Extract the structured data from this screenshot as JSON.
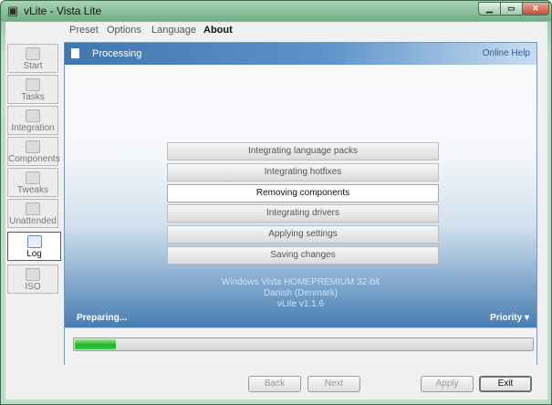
{
  "window": {
    "title": "vLite - Vista Lite",
    "app_icon": "vlite-app-icon",
    "controls": {
      "minimize": "▁",
      "maximize": "▭",
      "close": "✕"
    }
  },
  "menu": [
    "Preset",
    "Options",
    "Language",
    "About"
  ],
  "sidebar": {
    "items": [
      {
        "label": "Start",
        "icon": "start-icon",
        "active": false
      },
      {
        "label": "Tasks",
        "icon": "tasks-icon",
        "active": false
      },
      {
        "label": "Integration",
        "icon": "integration-icon",
        "active": false
      },
      {
        "label": "Components",
        "icon": "components-icon",
        "active": false
      },
      {
        "label": "Tweaks",
        "icon": "tweaks-icon",
        "active": false
      },
      {
        "label": "Unattended",
        "icon": "unattended-icon",
        "active": false
      },
      {
        "label": "Log",
        "icon": "log-icon",
        "active": true
      },
      {
        "label": "ISO",
        "icon": "iso-icon",
        "active": false
      }
    ]
  },
  "panel": {
    "title": "Processing",
    "help_link": "Online Help",
    "steps": [
      {
        "label": "Integrating language packs",
        "current": false
      },
      {
        "label": "Integrating hotfixes",
        "current": false
      },
      {
        "label": "Removing components",
        "current": true
      },
      {
        "label": "Integrating drivers",
        "current": false
      },
      {
        "label": "Applying settings",
        "current": false
      },
      {
        "label": "Saving changes",
        "current": false
      }
    ],
    "info": {
      "edition": "Windows Vista HOMEPREMIUM 32-bit",
      "language": "Danish (Denmark)",
      "version": "vLite v1.1.6"
    },
    "status": "Preparing...",
    "priority_label": "Priority",
    "progress": 0.09
  },
  "buttons": {
    "back": "Back",
    "next": "Next",
    "apply": "Apply",
    "exit": "Exit"
  },
  "colors": {
    "progress_fill": "#1fb42c",
    "panel_header": "#3f77b0",
    "help_link": "#2b5f9b"
  }
}
